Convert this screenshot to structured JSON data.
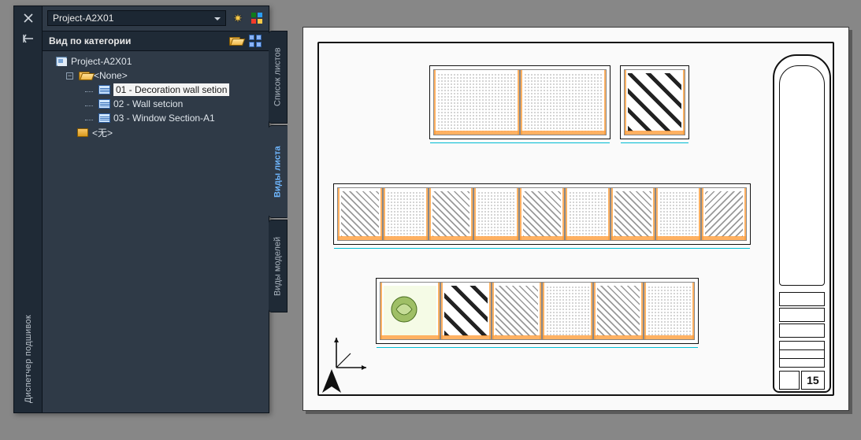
{
  "panel_title": "Диспетчер подшивок",
  "project": "Project-A2X01",
  "section_title": "Вид по категории",
  "tabs": {
    "sheets": "Список листов",
    "views": "Виды листа",
    "models": "Виды моделей"
  },
  "tree": {
    "root": "Project-A2X01",
    "group_none": "<None>",
    "items": [
      "01 - Decoration wall setion",
      "02 - Wall setcion",
      "03 - Window Section-A1"
    ],
    "group_empty": "<无>"
  },
  "titleblock": {
    "sheet_number": "15"
  }
}
